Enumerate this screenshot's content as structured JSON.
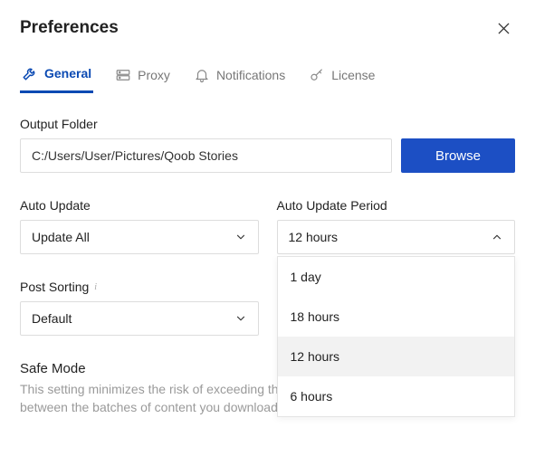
{
  "title": "Preferences",
  "tabs": {
    "general": "General",
    "proxy": "Proxy",
    "notifications": "Notifications",
    "license": "License"
  },
  "outputFolder": {
    "label": "Output Folder",
    "value": "C:/Users/User/Pictures/Qoob Stories",
    "browse": "Browse"
  },
  "autoUpdate": {
    "label": "Auto Update",
    "value": "Update All"
  },
  "autoUpdatePeriod": {
    "label": "Auto Update Period",
    "value": "12 hours",
    "options": [
      "1 day",
      "18 hours",
      "12 hours",
      "6 hours"
    ]
  },
  "postSorting": {
    "label": "Post Sorting",
    "value": "Default"
  },
  "safeMode": {
    "label": "Safe Mode",
    "desc": "This setting minimizes the risk of exceeding the Instagram limits by adding pauses between the batches of content you download."
  }
}
